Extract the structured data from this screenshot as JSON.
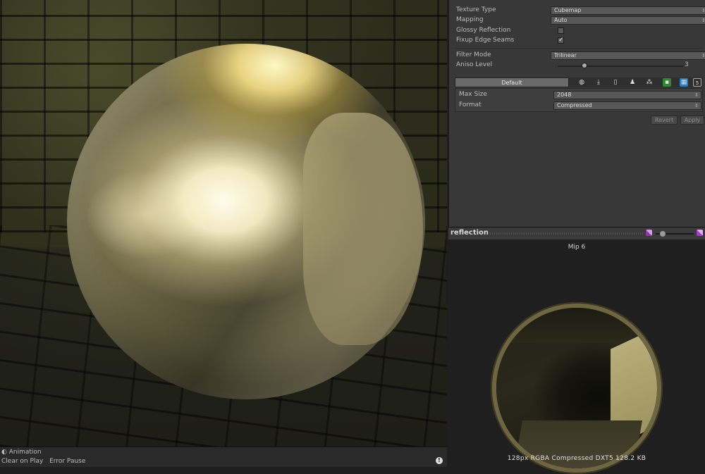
{
  "scene": {
    "status_bar": {
      "header_label": "Animation",
      "toggles": [
        "Clear on Play",
        "Error Pause"
      ]
    }
  },
  "inspector": {
    "texture_type": {
      "label": "Texture Type",
      "value": "Cubemap"
    },
    "mapping": {
      "label": "Mapping",
      "value": "Auto"
    },
    "glossy_reflection": {
      "label": "Glossy Reflection",
      "checked": false
    },
    "fixup_edge_seams": {
      "label": "Fixup Edge Seams",
      "checked": true,
      "check_glyph": "✓"
    },
    "filter_mode": {
      "label": "Filter Mode",
      "value": "Trilinear"
    },
    "aniso_level": {
      "label": "Aniso Level",
      "value": "3",
      "slider_fraction": 0.2
    },
    "platform_tabs": {
      "default_label": "Default",
      "icons": [
        "web-icon",
        "standalone-icon",
        "iphone-icon",
        "android-icon",
        "blackberry-icon",
        "xbox-icon",
        "windows-store-icon",
        "html5-icon"
      ]
    },
    "max_size": {
      "label": "Max Size",
      "value": "2048"
    },
    "format": {
      "label": "Format",
      "value": "Compressed"
    },
    "revert_label": "Revert",
    "apply_label": "Apply"
  },
  "preview": {
    "title": "reflection",
    "mip_label": "Mip 6",
    "info": "128px RGBA Compressed DXT5 128.2 KB"
  },
  "colors": {
    "panel_bg": "#383838",
    "preview_bg": "#1f1f1f",
    "sphere_gold": "#8a8262"
  }
}
